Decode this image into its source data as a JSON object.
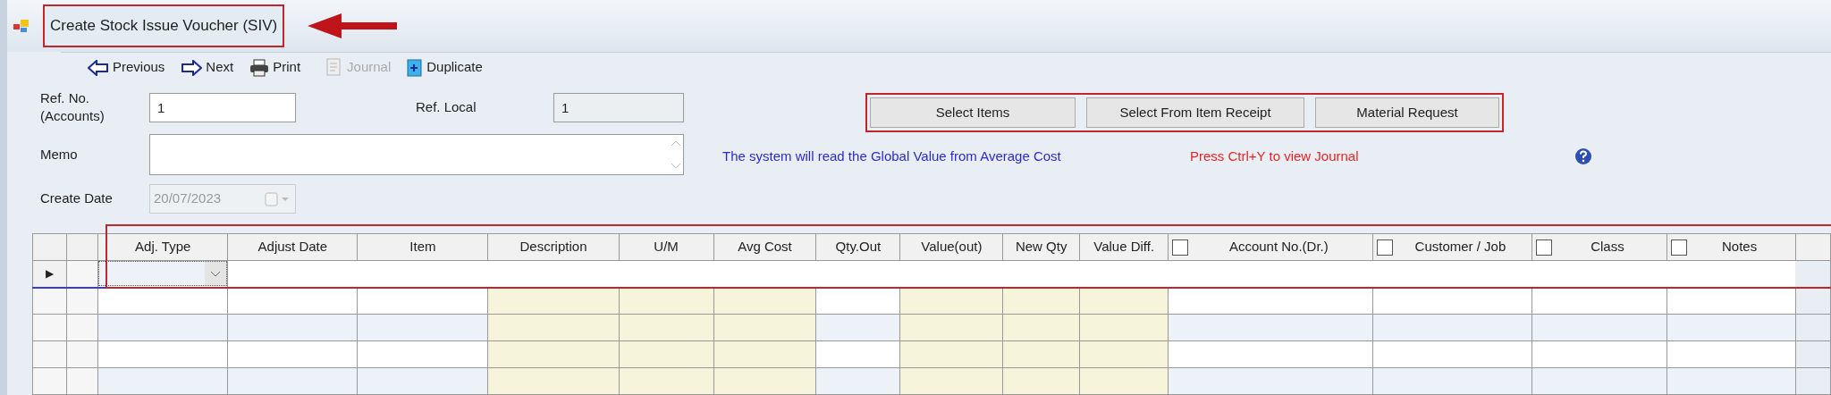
{
  "window": {
    "title": "Create Stock Issue Voucher (SIV)"
  },
  "toolbar": [
    {
      "kind": "previous",
      "label": "Previous",
      "disabled": false
    },
    {
      "kind": "next",
      "label": "Next",
      "disabled": false
    },
    {
      "kind": "print",
      "label": "Print",
      "disabled": false
    },
    {
      "kind": "journal",
      "label": "Journal",
      "disabled": true
    },
    {
      "kind": "duplicate",
      "label": "Duplicate",
      "disabled": false
    }
  ],
  "form": {
    "ref_no": {
      "label": "Ref. No.\n(Accounts)",
      "value": "1"
    },
    "ref_local": {
      "label": "Ref. Local",
      "value": "1"
    },
    "memo": {
      "label": "Memo"
    },
    "create_date": {
      "label": "Create Date",
      "value": "20/07/2023",
      "disabled": true
    }
  },
  "actions": [
    "Select Items",
    "Select From Item Receipt",
    "Material Request"
  ],
  "notes": {
    "info": "The system will read the Global Value from Average Cost",
    "hint": "Press Ctrl+Y to view Journal"
  },
  "grid": {
    "columns": [
      {
        "label": "Adj. Type",
        "kind": "input"
      },
      {
        "label": "Adjust Date",
        "kind": "input"
      },
      {
        "label": "Item",
        "kind": "input"
      },
      {
        "label": "Description",
        "kind": "computed"
      },
      {
        "label": "U/M",
        "kind": "computed"
      },
      {
        "label": "Avg Cost",
        "kind": "computed"
      },
      {
        "label": "Qty.Out",
        "kind": "input"
      },
      {
        "label": "Value(out)",
        "kind": "computed"
      },
      {
        "label": "New Qty",
        "kind": "computed"
      },
      {
        "label": "Value Diff.",
        "kind": "computed"
      },
      {
        "label": "Account No.(Dr.)",
        "kind": "input",
        "checked": false
      },
      {
        "label": "Customer / Job",
        "kind": "input",
        "checked": false
      },
      {
        "label": "Class",
        "kind": "input",
        "checked": false
      },
      {
        "label": "Notes",
        "kind": "input",
        "checked": false
      }
    ],
    "rows": [
      {
        "marker": "▶",
        "current": true
      },
      {
        "current": false
      },
      {
        "current": false
      },
      {
        "current": false
      },
      {
        "current": false
      }
    ]
  }
}
